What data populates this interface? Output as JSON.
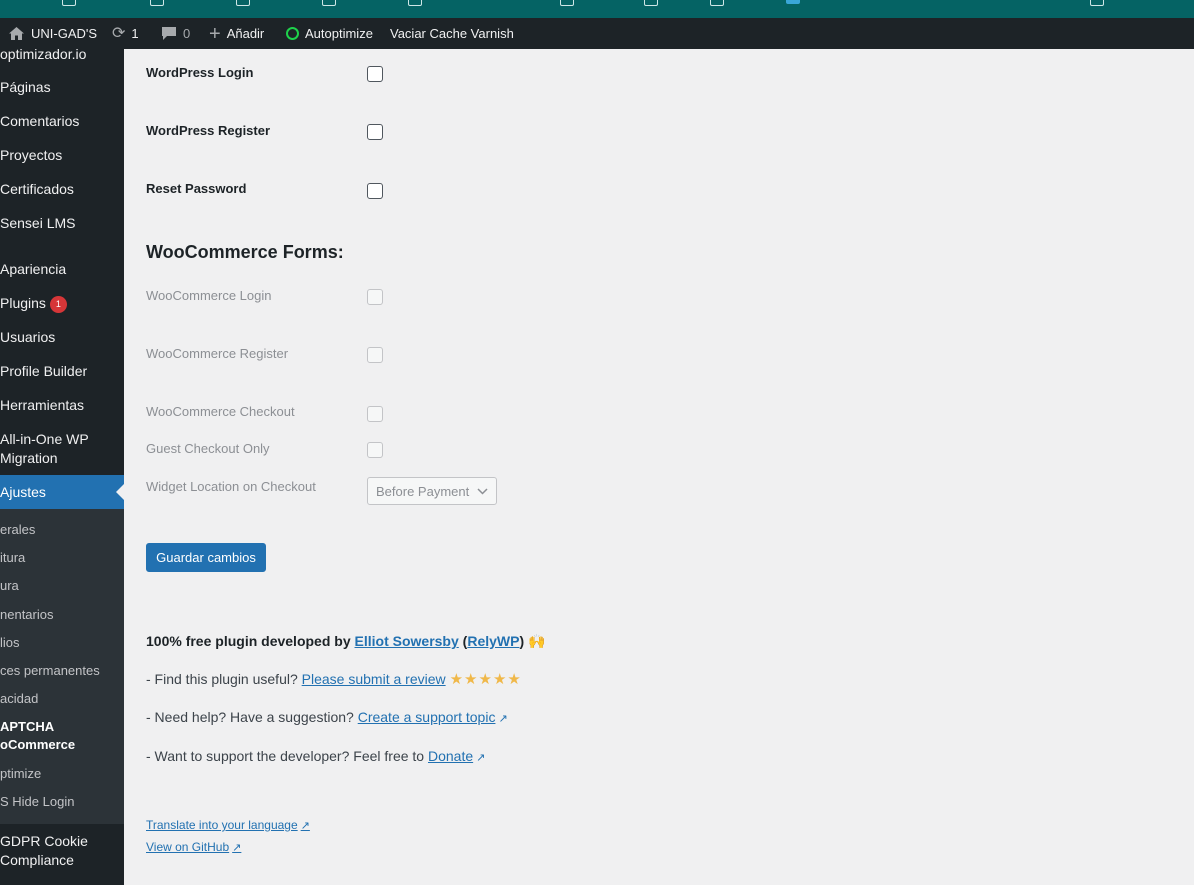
{
  "colors": {
    "admin_bar": "#1d2327",
    "accent": "#2271b1",
    "browser_bar": "#056364",
    "badge": "#d63638",
    "star": "#f0b849"
  },
  "adminbar": {
    "site_name": "UNI-GAD'S",
    "updates_count": "1",
    "comments_count": "0",
    "new_label": "Añadir",
    "autoptimize_label": "Autoptimize",
    "varnish_label": "Vaciar Cache Varnish"
  },
  "sidebar": {
    "items": [
      {
        "label": "optimizador.io"
      },
      {
        "label": "Páginas"
      },
      {
        "label": "Comentarios"
      },
      {
        "label": "Proyectos"
      },
      {
        "label": "Certificados"
      },
      {
        "label": "Sensei LMS"
      },
      {
        "label": "Apariencia"
      },
      {
        "label": "Plugins",
        "badge": "1"
      },
      {
        "label": "Usuarios"
      },
      {
        "label": "Profile Builder"
      },
      {
        "label": "Herramientas"
      },
      {
        "label": "All-in-One WP",
        "label2": "Migration"
      },
      {
        "label": "Ajustes"
      },
      {
        "label": "GDPR Cookie",
        "label2": "Compliance"
      }
    ],
    "submenu": [
      {
        "label": "erales"
      },
      {
        "label": "itura"
      },
      {
        "label": "ura"
      },
      {
        "label": "nentarios"
      },
      {
        "label": "lios"
      },
      {
        "label": "ces permanentes"
      },
      {
        "label": "acidad"
      },
      {
        "label": "APTCHA",
        "label2": "oCommerce"
      },
      {
        "label": "ptimize"
      },
      {
        "label": "S Hide Login"
      }
    ]
  },
  "main": {
    "wp_forms": [
      {
        "label": "WordPress Login",
        "checked": false
      },
      {
        "label": "WordPress Register",
        "checked": false
      },
      {
        "label": "Reset Password",
        "checked": false
      }
    ],
    "woo_title": "WooCommerce Forms:",
    "woo_forms": [
      {
        "label": "WooCommerce Login",
        "checked": false
      },
      {
        "label": "WooCommerce Register",
        "checked": false
      },
      {
        "label": "WooCommerce Checkout",
        "checked": false
      },
      {
        "label": "Guest Checkout Only",
        "checked": false
      }
    ],
    "widget_location_label": "Widget Location on Checkout",
    "widget_location_value": "Before Payment",
    "save_button": "Guardar cambios",
    "credits": {
      "line1_prefix": "100% free plugin developed by",
      "author": "Elliot Sowersby",
      "company": "RelyWP",
      "emoji": "🙌",
      "line2_prefix": "- Find this plugin useful?",
      "review_link": "Please submit a review",
      "stars": "★★★★★",
      "line3_prefix": "- Need help? Have a suggestion?",
      "support_link": "Create a support topic",
      "line4_prefix": "- Want to support the developer? Feel free to",
      "donate_link": "Donate"
    },
    "translate_link": "Translate into your language",
    "github_link": "View on GitHub"
  }
}
